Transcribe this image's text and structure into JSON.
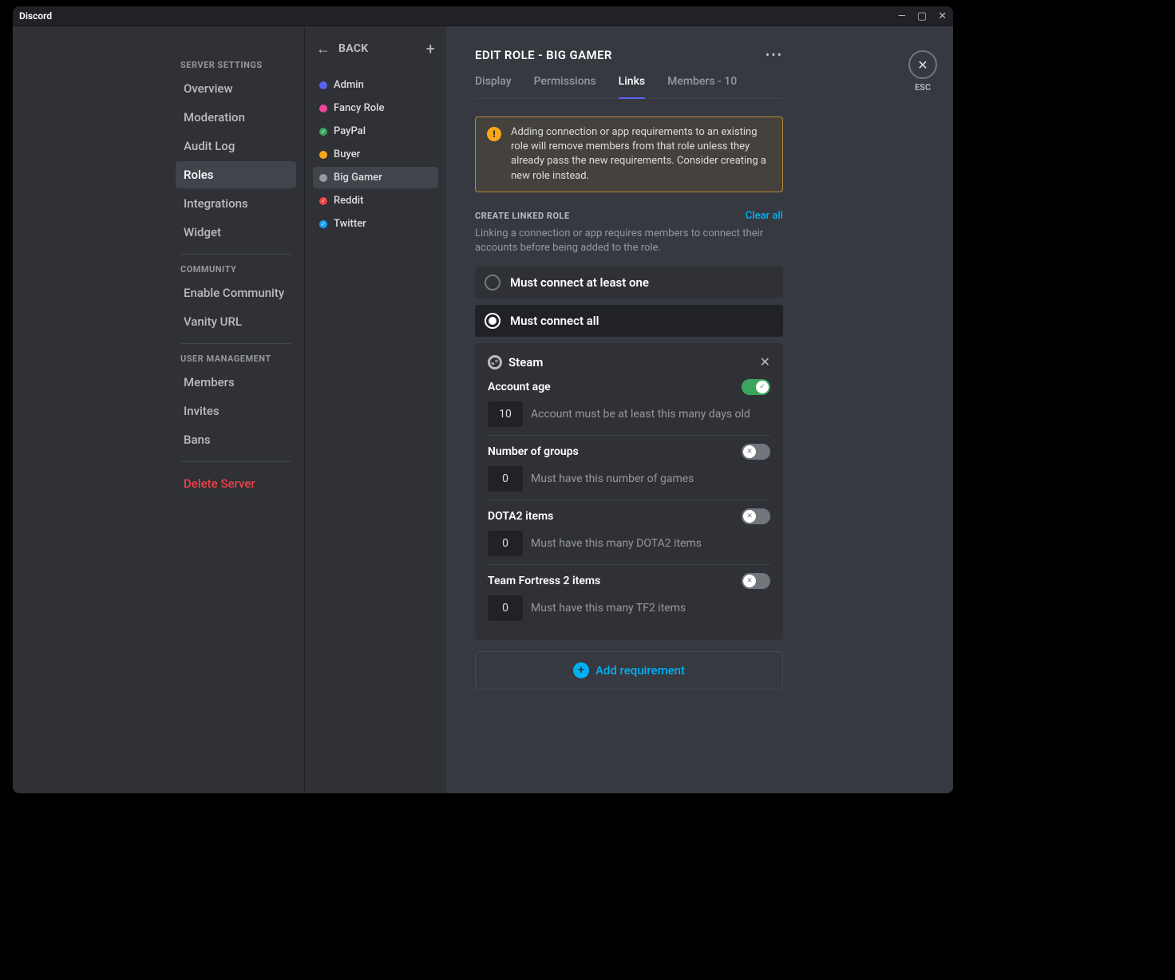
{
  "titlebar": {
    "brand": "Discord"
  },
  "sidebar": {
    "group1_header": "SERVER SETTINGS",
    "items1": [
      "Overview",
      "Moderation",
      "Audit Log",
      "Roles",
      "Integrations",
      "Widget"
    ],
    "group2_header": "COMMUNITY",
    "items2": [
      "Enable Community",
      "Vanity URL"
    ],
    "group3_header": "USER MANAGEMENT",
    "items3": [
      "Members",
      "Invites",
      "Bans"
    ],
    "delete": "Delete Server"
  },
  "roles": {
    "back": "BACK",
    "list": [
      {
        "name": "Admin",
        "color": "#5865f2",
        "check": false
      },
      {
        "name": "Fancy Role",
        "color": "#eb459e",
        "check": false
      },
      {
        "name": "PayPal",
        "color": "#3ba55d",
        "check": true
      },
      {
        "name": "Buyer",
        "color": "#faa61a",
        "check": false
      },
      {
        "name": "Big Gamer",
        "color": "#96989d",
        "check": false
      },
      {
        "name": "Reddit",
        "color": "#ed4245",
        "check": true
      },
      {
        "name": "Twitter",
        "color": "#1da1f2",
        "check": true
      }
    ],
    "active_index": 4
  },
  "page": {
    "title": "EDIT ROLE  -  BIG GAMER",
    "esc": "ESC",
    "tabs": [
      "Display",
      "Permissions",
      "Links",
      "Members - 10"
    ],
    "active_tab": 2,
    "warning": "Adding connection or app requirements to an existing role will remove members from that role unless they already pass the new requirements. Consider creating a new role instead.",
    "section_title": "CREATE LINKED ROLE",
    "clear_all": "Clear all",
    "section_desc": "Linking a connection or app requires members to connect their accounts before being added to the role.",
    "radio_one": "Must connect at least one",
    "radio_all": "Must connect all",
    "req": {
      "name": "Steam",
      "rows": [
        {
          "label": "Account age",
          "value": "10",
          "desc": "Account must be at least this many days old",
          "on": true
        },
        {
          "label": "Number of groups",
          "value": "0",
          "desc": "Must have this number of games",
          "on": false
        },
        {
          "label": "DOTA2 items",
          "value": "0",
          "desc": "Must have this many DOTA2 items",
          "on": false
        },
        {
          "label": "Team Fortress 2 items",
          "value": "0",
          "desc": "Must have this many TF2 items",
          "on": false
        }
      ]
    },
    "add_req": "Add requirement"
  }
}
